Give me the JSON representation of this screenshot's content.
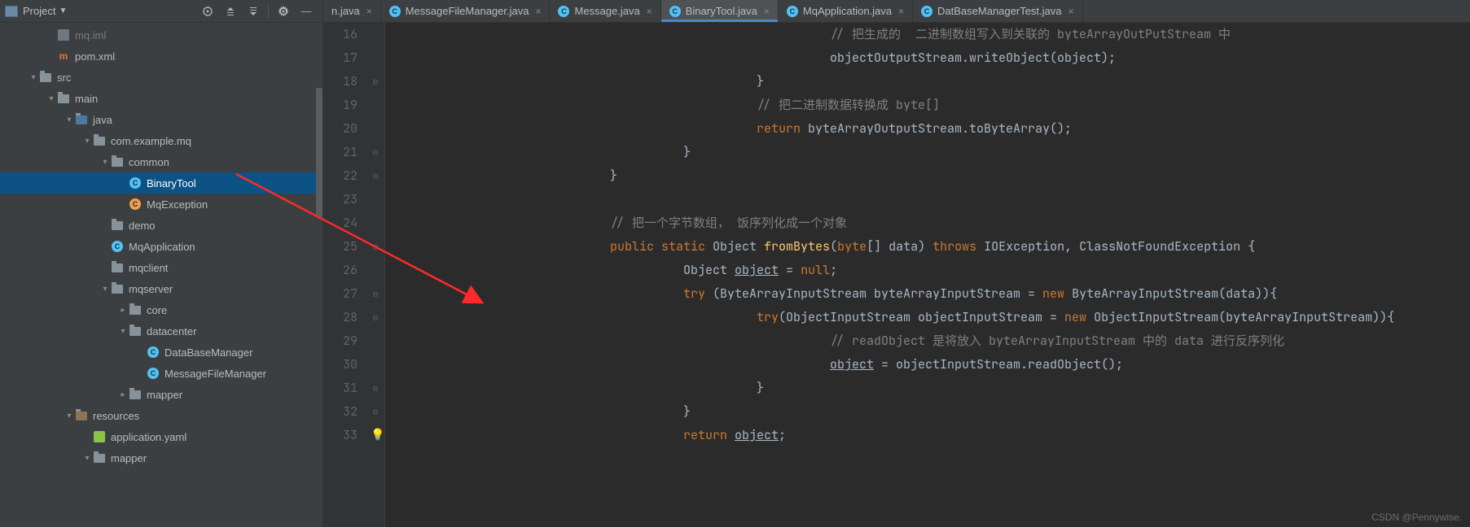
{
  "sidebar": {
    "title": "Project",
    "tree": [
      {
        "depth": 2,
        "arrow": "",
        "icon": "file",
        "label": "mq.iml",
        "dim": true
      },
      {
        "depth": 2,
        "arrow": "",
        "icon": "maven",
        "label": "pom.xml"
      },
      {
        "depth": 1,
        "arrow": "▾",
        "icon": "folder",
        "label": "src"
      },
      {
        "depth": 2,
        "arrow": "▾",
        "icon": "folder",
        "label": "main"
      },
      {
        "depth": 3,
        "arrow": "▾",
        "icon": "folder-src",
        "label": "java"
      },
      {
        "depth": 4,
        "arrow": "▾",
        "icon": "folder",
        "label": "com.example.mq"
      },
      {
        "depth": 5,
        "arrow": "▾",
        "icon": "folder",
        "label": "common"
      },
      {
        "depth": 6,
        "arrow": "",
        "icon": "class-c",
        "label": "BinaryTool",
        "selected": true
      },
      {
        "depth": 6,
        "arrow": "",
        "icon": "class-e",
        "label": "MqException"
      },
      {
        "depth": 5,
        "arrow": "",
        "icon": "folder",
        "label": "demo"
      },
      {
        "depth": 5,
        "arrow": "",
        "icon": "class-c",
        "label": "MqApplication"
      },
      {
        "depth": 5,
        "arrow": "",
        "icon": "folder",
        "label": "mqclient"
      },
      {
        "depth": 5,
        "arrow": "▾",
        "icon": "folder",
        "label": "mqserver"
      },
      {
        "depth": 6,
        "arrow": "▸",
        "icon": "folder",
        "label": "core"
      },
      {
        "depth": 6,
        "arrow": "▾",
        "icon": "folder",
        "label": "datacenter"
      },
      {
        "depth": 7,
        "arrow": "",
        "icon": "class-c",
        "label": "DataBaseManager"
      },
      {
        "depth": 7,
        "arrow": "",
        "icon": "class-c",
        "label": "MessageFileManager"
      },
      {
        "depth": 6,
        "arrow": "▸",
        "icon": "folder",
        "label": "mapper"
      },
      {
        "depth": 3,
        "arrow": "▾",
        "icon": "folder-res",
        "label": "resources"
      },
      {
        "depth": 4,
        "arrow": "",
        "icon": "yaml",
        "label": "application.yaml"
      },
      {
        "depth": 4,
        "arrow": "▾",
        "icon": "folder",
        "label": "mapper"
      }
    ]
  },
  "tabs": [
    {
      "label": "n.java",
      "active": false,
      "truncated": true
    },
    {
      "label": "MessageFileManager.java",
      "active": false
    },
    {
      "label": "Message.java",
      "active": false
    },
    {
      "label": "BinaryTool.java",
      "active": true
    },
    {
      "label": "MqApplication.java",
      "active": false
    },
    {
      "label": "DatBaseManagerTest.java",
      "active": false
    }
  ],
  "code": {
    "first_line": 16,
    "lines": [
      {
        "n": 16,
        "ind": 12,
        "tokens": [
          {
            "t": "// 把生成的  二进制数组写入到关联的 byteArrayOutPutStream 中",
            "c": "com"
          }
        ]
      },
      {
        "n": 17,
        "ind": 12,
        "tokens": [
          {
            "t": "objectOutputStream.writeObject(object);"
          }
        ]
      },
      {
        "n": 18,
        "ind": 10,
        "tokens": [
          {
            "t": "}"
          }
        ]
      },
      {
        "n": 19,
        "ind": 10,
        "tokens": [
          {
            "t": "// 把二进制数据转换成 byte[]",
            "c": "com"
          }
        ]
      },
      {
        "n": 20,
        "ind": 10,
        "tokens": [
          {
            "t": "return ",
            "c": "kw"
          },
          {
            "t": "byteArrayOutputStream.toByteArray();"
          }
        ]
      },
      {
        "n": 21,
        "ind": 8,
        "tokens": [
          {
            "t": "}"
          }
        ]
      },
      {
        "n": 22,
        "ind": 6,
        "tokens": [
          {
            "t": "}"
          }
        ]
      },
      {
        "n": 23,
        "ind": 0,
        "tokens": []
      },
      {
        "n": 24,
        "ind": 6,
        "tokens": [
          {
            "t": "// 把一个字节数组， 饭序列化成一个对象",
            "c": "com"
          }
        ]
      },
      {
        "n": 25,
        "ind": 6,
        "tokens": [
          {
            "t": "public static ",
            "c": "kw"
          },
          {
            "t": "Object "
          },
          {
            "t": "fromBytes",
            "c": "method"
          },
          {
            "t": "("
          },
          {
            "t": "byte",
            "c": "kw"
          },
          {
            "t": "[] data) "
          },
          {
            "t": "throws ",
            "c": "kw"
          },
          {
            "t": "IOException, ClassNotFoundException {"
          }
        ]
      },
      {
        "n": 26,
        "ind": 8,
        "tokens": [
          {
            "t": "Object "
          },
          {
            "t": "object",
            "c": "underline"
          },
          {
            "t": " = "
          },
          {
            "t": "null",
            "c": "kw"
          },
          {
            "t": ";"
          }
        ]
      },
      {
        "n": 27,
        "ind": 8,
        "tokens": [
          {
            "t": "try ",
            "c": "kw"
          },
          {
            "t": "(ByteArrayInputStream byteArrayInputStream = "
          },
          {
            "t": "new ",
            "c": "kw"
          },
          {
            "t": "ByteArrayInputStream(data)){"
          }
        ]
      },
      {
        "n": 28,
        "ind": 10,
        "tokens": [
          {
            "t": "try",
            "c": "kw"
          },
          {
            "t": "(ObjectInputStream objectInputStream = "
          },
          {
            "t": "new ",
            "c": "kw"
          },
          {
            "t": "ObjectInputStream(byteArrayInputStream)){"
          }
        ]
      },
      {
        "n": 29,
        "ind": 12,
        "tokens": [
          {
            "t": "// readObject 是将放入 byteArrayInputStream 中的 data 进行反序列化",
            "c": "com"
          }
        ]
      },
      {
        "n": 30,
        "ind": 12,
        "tokens": [
          {
            "t": "object",
            "c": "underline"
          },
          {
            "t": " = objectInputStream.readObject();"
          }
        ]
      },
      {
        "n": 31,
        "ind": 10,
        "tokens": [
          {
            "t": "}"
          }
        ]
      },
      {
        "n": 32,
        "ind": 8,
        "tokens": [
          {
            "t": "}"
          }
        ]
      },
      {
        "n": 33,
        "ind": 8,
        "bulb": true,
        "tokens": [
          {
            "t": "return ",
            "c": "kw"
          },
          {
            "t": "object",
            "c": "underline"
          },
          {
            "t": ";"
          }
        ]
      }
    ]
  },
  "watermark": "CSDN @Pennywise."
}
